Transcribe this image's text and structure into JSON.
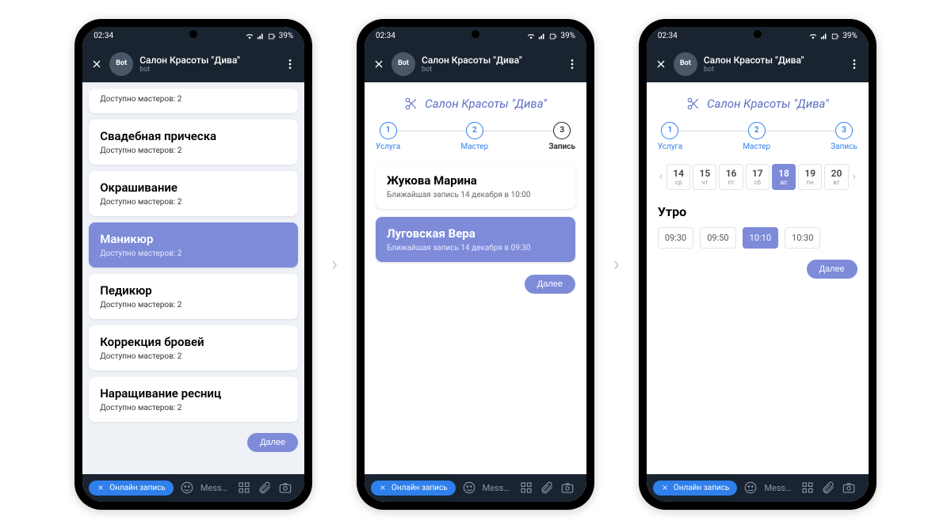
{
  "status": {
    "time": "02:34",
    "battery": "39%"
  },
  "header": {
    "badge": "Bot",
    "title": "Салон Красоты \"Дива\"",
    "subtitle": "bot"
  },
  "salonTitle": "Салон Красоты \"Дива\"",
  "steps": {
    "s1": {
      "num": "1",
      "label": "Услуга"
    },
    "s2": {
      "num": "2",
      "label": "Мастер"
    },
    "s3": {
      "num": "3",
      "label": "Запись"
    }
  },
  "screen1": {
    "partialSub": "Доступно мастеров: 2",
    "services": [
      {
        "title": "Свадебная прическа",
        "sub": "Доступно мастеров: 2"
      },
      {
        "title": "Окрашивание",
        "sub": "Доступно мастеров: 2"
      },
      {
        "title": "Маникюр",
        "sub": "Доступно мастеров: 2"
      },
      {
        "title": "Педикюр",
        "sub": "Доступно мастеров: 2"
      },
      {
        "title": "Коррекция бровей",
        "sub": "Доступно мастеров: 2"
      },
      {
        "title": "Наращивание ресниц",
        "sub": "Доступно мастеров: 2"
      }
    ],
    "nextBtn": "Далее"
  },
  "screen2": {
    "masters": [
      {
        "name": "Жукова Марина",
        "sub": "Ближайшая запись 14 декабря в 10:00"
      },
      {
        "name": "Луговская Вера",
        "sub": "Ближайшая запись 14 декабря в 09:30"
      }
    ],
    "nextBtn": "Далее"
  },
  "screen3": {
    "dates": [
      {
        "n": "14",
        "w": "ср"
      },
      {
        "n": "15",
        "w": "чт"
      },
      {
        "n": "16",
        "w": "пт"
      },
      {
        "n": "17",
        "w": "сб"
      },
      {
        "n": "18",
        "w": "вс"
      },
      {
        "n": "19",
        "w": "пн"
      },
      {
        "n": "20",
        "w": "вт"
      }
    ],
    "section": "Утро",
    "slots": [
      "09:30",
      "09:50",
      "10:10",
      "10:30"
    ],
    "nextBtn": "Далее"
  },
  "bottombar": {
    "pill": "Онлайн запись",
    "placeholder": "Mess…"
  }
}
